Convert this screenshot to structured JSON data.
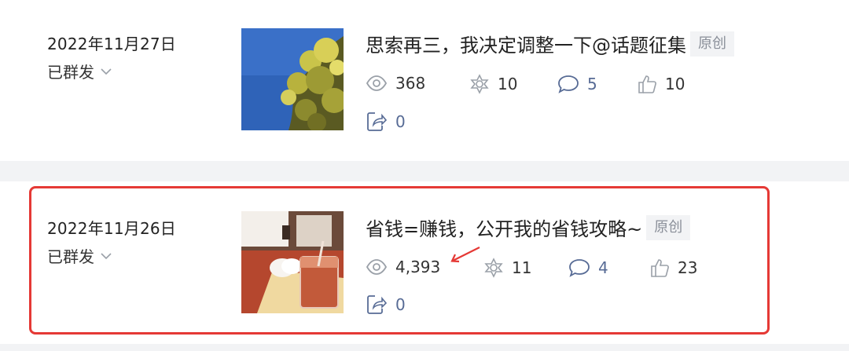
{
  "posts": [
    {
      "date": "2022年11月27日",
      "status": "已群发",
      "title": "思索再三，我决定调整一下@话题征集",
      "badge": "原创",
      "views": "368",
      "shares_ring": "10",
      "comments": "5",
      "likes": "10",
      "forwards": "0"
    },
    {
      "date": "2022年11月26日",
      "status": "已群发",
      "title": "省钱=赚钱，公开我的省钱攻略~",
      "badge": "原创",
      "views": "4,393",
      "shares_ring": "11",
      "comments": "4",
      "likes": "23",
      "forwards": "0"
    }
  ],
  "colors": {
    "highlight": "#e53935",
    "accent_blue": "#576b95",
    "separator": "#f2f3f5"
  },
  "icons": [
    "eye-icon",
    "share-ring-icon",
    "comment-icon",
    "thumbs-up-icon",
    "forward-icon",
    "chevron-down-icon"
  ]
}
